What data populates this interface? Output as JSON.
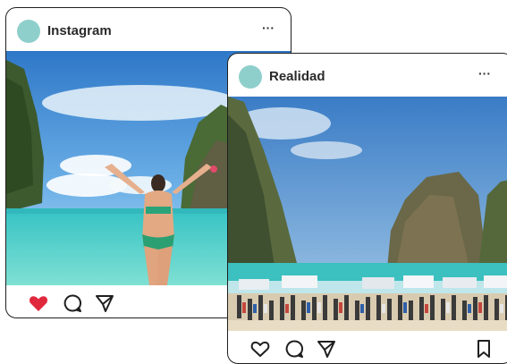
{
  "posts": [
    {
      "id_label": "back",
      "username": "Instagram",
      "more_label": "···",
      "liked": true,
      "icons": [
        "heart-icon",
        "comment-icon",
        "share-icon"
      ]
    },
    {
      "id_label": "front",
      "username": "Realidad",
      "more_label": "···",
      "liked": false,
      "icons": [
        "heart-icon",
        "comment-icon",
        "share-icon",
        "bookmark-icon"
      ]
    }
  ],
  "colors": {
    "avatar": "#8ecfcb",
    "like_red": "#e0283d",
    "border": "#1f1f1f"
  }
}
